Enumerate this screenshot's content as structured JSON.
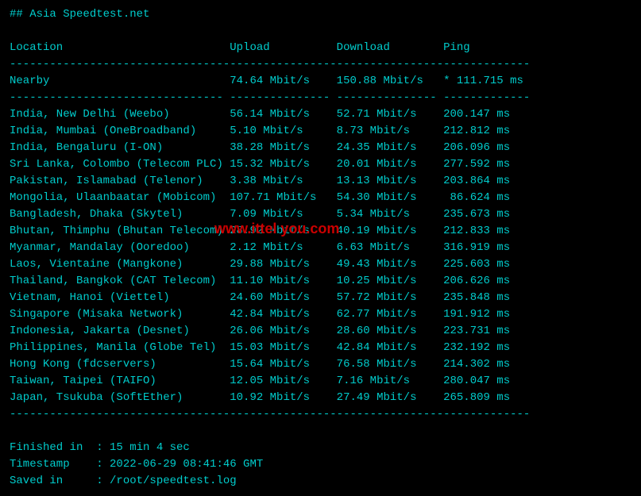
{
  "title": "## Asia Speedtest.net",
  "headers": {
    "location": "Location",
    "upload": "Upload",
    "download": "Download",
    "ping": "Ping"
  },
  "nearby": {
    "location": "Nearby",
    "upload": "74.64 Mbit/s",
    "download": "150.88 Mbit/s",
    "ping": "* 111.715 ms"
  },
  "rows": [
    {
      "location": "India, New Delhi (Weebo)",
      "upload": "56.14 Mbit/s",
      "download": "52.71 Mbit/s",
      "ping": "200.147 ms"
    },
    {
      "location": "India, Mumbai (OneBroadband)",
      "upload": "5.10 Mbit/s",
      "download": "8.73 Mbit/s",
      "ping": "212.812 ms"
    },
    {
      "location": "India, Bengaluru (I-ON)",
      "upload": "38.28 Mbit/s",
      "download": "24.35 Mbit/s",
      "ping": "206.096 ms"
    },
    {
      "location": "Sri Lanka, Colombo (Telecom PLC)",
      "upload": "15.32 Mbit/s",
      "download": "20.01 Mbit/s",
      "ping": "277.592 ms"
    },
    {
      "location": "Pakistan, Islamabad (Telenor)",
      "upload": "3.38 Mbit/s",
      "download": "13.13 Mbit/s",
      "ping": "203.864 ms"
    },
    {
      "location": "Mongolia, Ulaanbaatar (Mobicom)",
      "upload": "107.71 Mbit/s",
      "download": "54.30 Mbit/s",
      "ping": " 86.624 ms"
    },
    {
      "location": "Bangladesh, Dhaka (Skytel)",
      "upload": "7.09 Mbit/s",
      "download": "5.34 Mbit/s",
      "ping": "235.673 ms"
    },
    {
      "location": "Bhutan, Thimphu (Bhutan Telecom)",
      "upload": "28.92 Mbit/s",
      "download": "40.19 Mbit/s",
      "ping": "212.833 ms"
    },
    {
      "location": "Myanmar, Mandalay (Ooredoo)",
      "upload": "2.12 Mbit/s",
      "download": "6.63 Mbit/s",
      "ping": "316.919 ms"
    },
    {
      "location": "Laos, Vientaine (Mangkone)",
      "upload": "29.88 Mbit/s",
      "download": "49.43 Mbit/s",
      "ping": "225.603 ms"
    },
    {
      "location": "Thailand, Bangkok (CAT Telecom)",
      "upload": "11.10 Mbit/s",
      "download": "10.25 Mbit/s",
      "ping": "206.626 ms"
    },
    {
      "location": "Vietnam, Hanoi (Viettel)",
      "upload": "24.60 Mbit/s",
      "download": "57.72 Mbit/s",
      "ping": "235.848 ms"
    },
    {
      "location": "Singapore (Misaka Network)",
      "upload": "42.84 Mbit/s",
      "download": "62.77 Mbit/s",
      "ping": "191.912 ms"
    },
    {
      "location": "Indonesia, Jakarta (Desnet)",
      "upload": "26.06 Mbit/s",
      "download": "28.60 Mbit/s",
      "ping": "223.731 ms"
    },
    {
      "location": "Philippines, Manila (Globe Tel)",
      "upload": "15.03 Mbit/s",
      "download": "42.84 Mbit/s",
      "ping": "232.192 ms"
    },
    {
      "location": "Hong Kong (fdcservers)",
      "upload": "15.64 Mbit/s",
      "download": "76.58 Mbit/s",
      "ping": "214.302 ms"
    },
    {
      "location": "Taiwan, Taipei (TAIFO)",
      "upload": "12.05 Mbit/s",
      "download": "7.16 Mbit/s",
      "ping": "280.047 ms"
    },
    {
      "location": "Japan, Tsukuba (SoftEther)",
      "upload": "10.92 Mbit/s",
      "download": "27.49 Mbit/s",
      "ping": "265.809 ms"
    }
  ],
  "footer": {
    "finished_label": "Finished in  :",
    "finished_value": "15 min 4 sec",
    "timestamp_label": "Timestamp    :",
    "timestamp_value": "2022-06-29 08:41:46 GMT",
    "saved_label": "Saved in     :",
    "saved_value": "/root/speedtest.log"
  },
  "watermark": "www.ittel you.com",
  "cols": {
    "location": 33,
    "upload": 16,
    "download": 16,
    "ping": 13
  }
}
